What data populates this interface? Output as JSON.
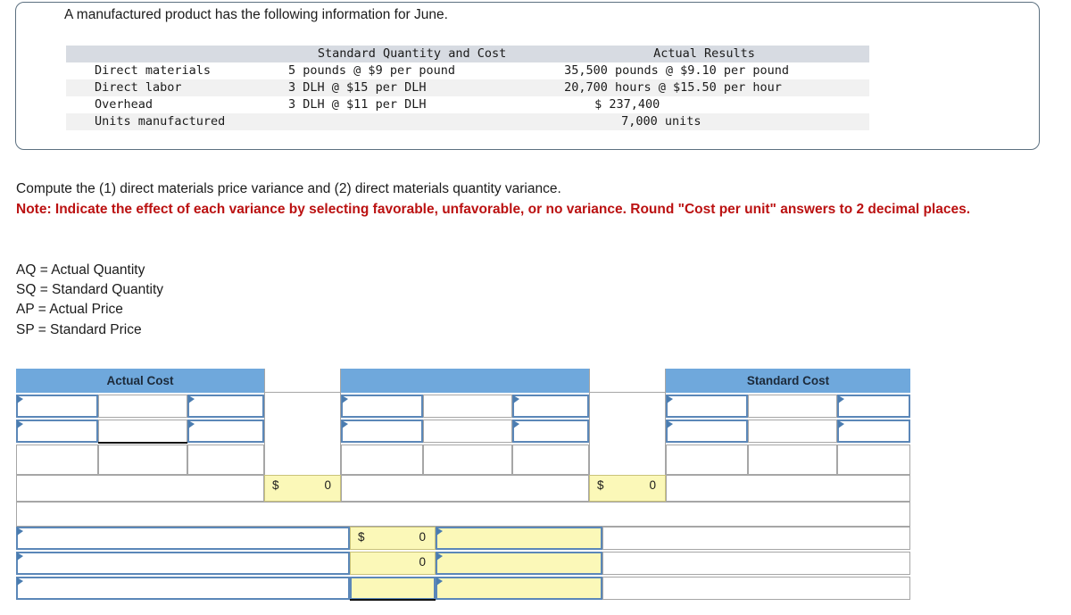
{
  "info_panel": {
    "title": "A manufactured product has the following information for June.",
    "table": {
      "headers": [
        "",
        "Standard Quantity and Cost",
        "Actual Results"
      ],
      "rows": [
        {
          "label": "Direct materials",
          "standard": "5 pounds @ $9 per pound",
          "actual": "35,500 pounds @ $9.10 per pound"
        },
        {
          "label": "Direct labor",
          "standard": "3 DLH @ $15 per DLH",
          "actual": "20,700 hours @ $15.50 per hour"
        },
        {
          "label": "Overhead",
          "standard": "3 DLH @ $11 per DLH",
          "actual": "$ 237,400"
        },
        {
          "label": "Units manufactured",
          "standard": "",
          "actual": "7,000 units"
        }
      ]
    }
  },
  "prompt": {
    "question": "Compute the (1) direct materials price variance and (2) direct materials quantity variance.",
    "note": "Note: Indicate the effect of each variance by selecting favorable, unfavorable, or no variance. Round \"Cost per unit\" answers to 2 decimal places.",
    "legend": [
      "AQ = Actual Quantity",
      "SQ = Standard Quantity",
      "AP = Actual Price",
      "SP = Standard Price"
    ]
  },
  "answer_grid": {
    "headers": {
      "actual_cost": "Actual Cost",
      "middle": "",
      "standard_cost": "Standard Cost"
    },
    "totals": {
      "left_currency": "$",
      "left_value": "0",
      "right_currency": "$",
      "right_value": "0"
    },
    "variance_rows": [
      {
        "label": "",
        "currency": "$",
        "value": "0",
        "effect": ""
      },
      {
        "label": "",
        "currency": "",
        "value": "0",
        "effect": ""
      },
      {
        "label": "",
        "currency": "",
        "value": "",
        "effect": ""
      }
    ]
  },
  "colors": {
    "header_blue": "#6fa8dc",
    "input_border_blue": "#5b87b8",
    "answer_yellow": "#fbf8b8",
    "note_red": "#bb1111",
    "panel_border": "#5c7080",
    "grid_border": "#a6a6a6"
  }
}
